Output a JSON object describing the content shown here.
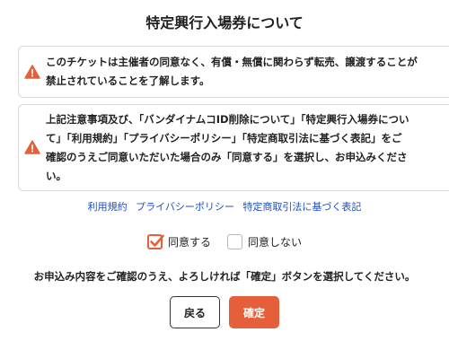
{
  "page": {
    "title": "特定興行入場券について"
  },
  "notices": [
    {
      "icon": "warning-icon",
      "lines": [
        "このチケットは主催者の同意なく、有償・無償に関わらず転売、譲渡することが",
        "禁止されていることを了解します。"
      ]
    },
    {
      "icon": "warning-icon",
      "lines": [
        "上記注意事項及び、「バンダイナムコID削除について」「特定興行入場券につい",
        "て」「利用規約」「プライバシーポリシー」「特定商取引法に基づく表記」をご",
        "確認のうえご同意いただいた場合のみ「同意する」を選択し、お申込みくださ",
        "い。"
      ]
    }
  ],
  "links": {
    "terms": "利用規約",
    "privacy": "プライバシーポリシー",
    "commerce": "特定商取引法に基づく表記"
  },
  "consent": {
    "agree_label": "同意する",
    "agree_checked": true,
    "disagree_label": "同意しない",
    "disagree_checked": false
  },
  "confirm_message": "お申込み内容をご確認のうえ、よろしければ「確定」ボタンを選択してください。",
  "buttons": {
    "back_label": "戻る",
    "confirm_label": "確定"
  },
  "colors": {
    "accent": "#e5603a",
    "link": "#1f4fc4",
    "warning": "#e5603a"
  }
}
